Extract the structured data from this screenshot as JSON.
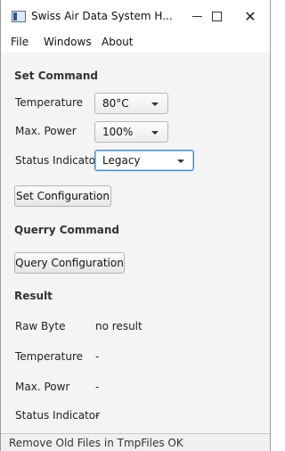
{
  "window": {
    "title": "Swiss Air Data System H...",
    "minimize_icon": "minimize-icon",
    "maximize_icon": "maximize-icon",
    "close_glyph": "✕"
  },
  "menubar": {
    "items": [
      {
        "label": "File"
      },
      {
        "label": "Windows"
      },
      {
        "label": "About"
      }
    ]
  },
  "set_command": {
    "title": "Set Command",
    "temperature": {
      "label": "Temperature",
      "selected": "80°C"
    },
    "max_power": {
      "label": "Max. Power",
      "selected": "100%"
    },
    "status_indicator": {
      "label": "Status Indicator",
      "selected": "Legacy"
    },
    "set_button": "Set Configuration"
  },
  "query_command": {
    "title": "Querry Command",
    "query_button": "Query Configuration"
  },
  "result": {
    "title": "Result",
    "rows": [
      {
        "label": "Raw Byte",
        "value": "no result"
      },
      {
        "label": "Temperature",
        "value": "-"
      },
      {
        "label": "Max. Powr",
        "value": "-"
      },
      {
        "label": "Status Indicator",
        "value": "-"
      }
    ]
  },
  "status": {
    "text": "Remove Old Files in TmpFiles OK"
  },
  "colors": {
    "focus_border": "#3a8ad6",
    "background": "#f4f4f4"
  }
}
